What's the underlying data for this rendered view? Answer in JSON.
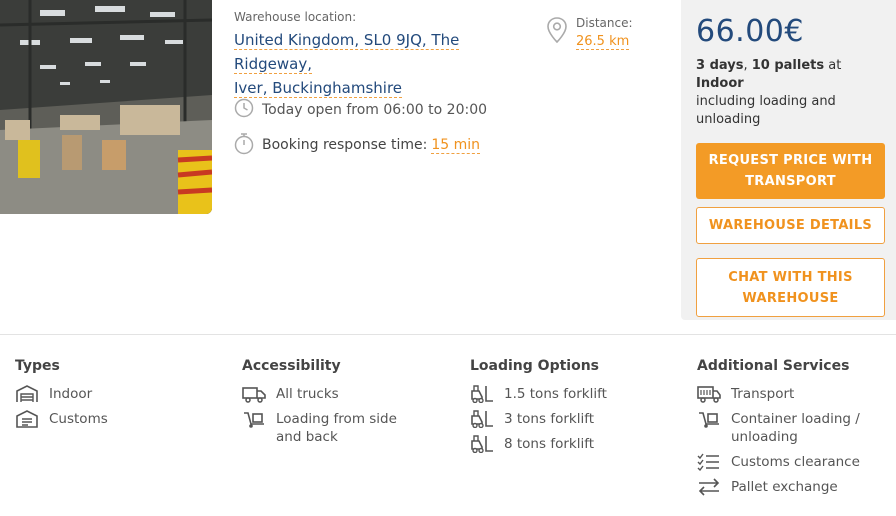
{
  "location": {
    "label": "Warehouse location:",
    "address_line1": "United Kingdom, SL0 9JQ, The Ridgeway,",
    "address_line2": "Iver, Buckinghamshire"
  },
  "distance": {
    "label": "Distance:",
    "value": "26.5 km"
  },
  "hours": {
    "text": "Today open from 06:00 to 20:00"
  },
  "booking": {
    "label": "Booking response time:",
    "value": "15 min"
  },
  "offer": {
    "price": "66.00€",
    "days": "3 days",
    "sep1": ", ",
    "pallets": "10 pallets",
    "at": " at ",
    "type": "Indoor",
    "includes": "including loading and unloading"
  },
  "buttons": {
    "request": "REQUEST PRICE WITH TRANSPORT",
    "details": "WAREHOUSE DETAILS",
    "chat": "CHAT WITH THIS WAREHOUSE"
  },
  "features": {
    "types": {
      "title": "Types",
      "items": [
        "Indoor",
        "Customs"
      ]
    },
    "accessibility": {
      "title": "Accessibility",
      "items": [
        "All trucks",
        "Loading from side and back"
      ]
    },
    "loading": {
      "title": "Loading Options",
      "items": [
        "1.5 tons forklift",
        "3 tons forklift",
        "8 tons forklift"
      ]
    },
    "services": {
      "title": "Additional Services",
      "items": [
        "Transport",
        "Container loading / unloading",
        "Customs clearance",
        "Pallet exchange"
      ]
    }
  },
  "colors": {
    "accent": "#f39b26",
    "brand": "#234a7c"
  },
  "icons": [
    "warehouse-icon",
    "customs-icon",
    "truck-icon",
    "hand-truck-icon",
    "forklift-icon",
    "checklist-icon",
    "exchange-icon",
    "clock-icon",
    "stopwatch-icon",
    "location-pin-icon"
  ]
}
